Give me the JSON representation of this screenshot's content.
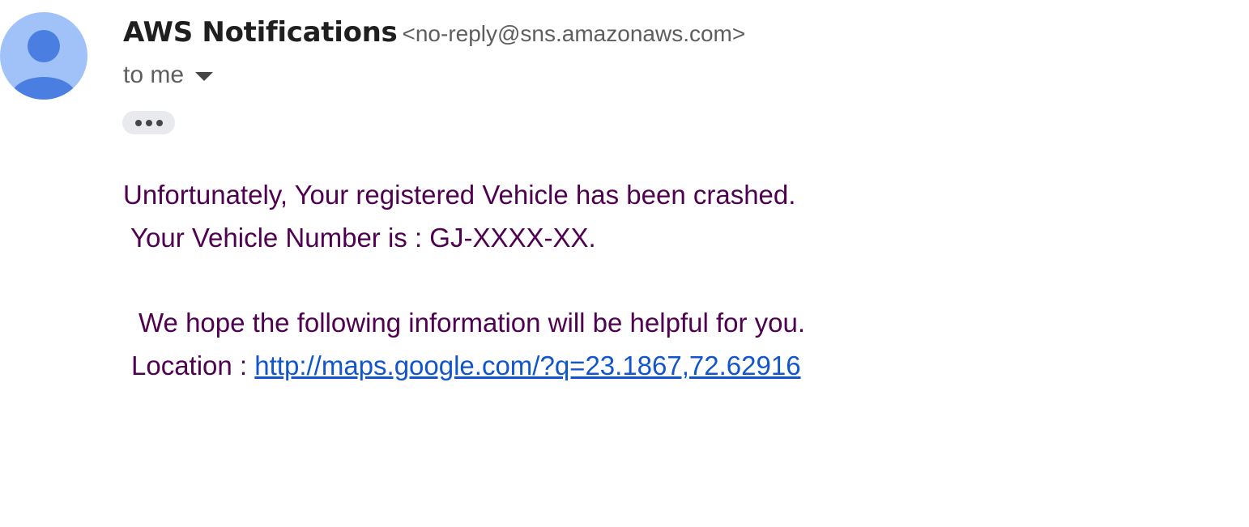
{
  "email": {
    "sender": {
      "name": "AWS Notifications",
      "address": "<no-reply@sns.amazonaws.com>",
      "avatar_icon": "person-icon",
      "avatar_bg": "#a0c2f9",
      "avatar_fg": "#4a7ee0"
    },
    "recipient_label": "to me",
    "more_button_icon": "ellipsis-icon",
    "body": {
      "line1": "Unfortunately, Your registered Vehicle has been crashed.",
      "line2": "Your Vehicle Number is : GJ-XXXX-XX.",
      "line3": "We hope the following information will be helpful for you.",
      "location_label": "Location : ",
      "location_url": "http://maps.google.com/?q=23.1867,72.62916",
      "text_color": "#500050",
      "link_color": "#1155cc"
    }
  }
}
